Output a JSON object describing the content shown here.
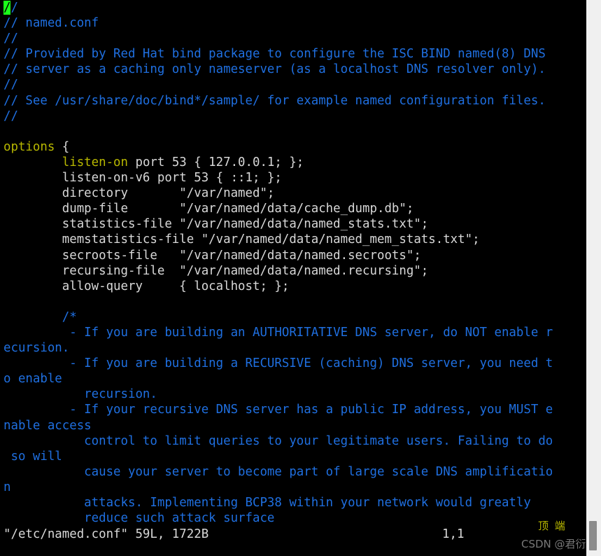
{
  "editor": {
    "app": "vim",
    "filename": "/etc/named.conf",
    "cursor_char": "/",
    "colors": {
      "background": "#000000",
      "comment": "#1f6fe0",
      "keyword": "#b8b800",
      "text": "#d8d8d8",
      "cursor": "#1aff1a",
      "rail": "#f0f0f0",
      "scroll_thumb": "#8c8c8c"
    },
    "lines": [
      {
        "id": "l1",
        "kind": "comment",
        "cursor": true,
        "text": "//"
      },
      {
        "id": "l2",
        "kind": "comment",
        "cursor": false,
        "text": "// named.conf"
      },
      {
        "id": "l3",
        "kind": "comment",
        "cursor": false,
        "text": "//"
      },
      {
        "id": "l4",
        "kind": "comment",
        "cursor": false,
        "text": "// Provided by Red Hat bind package to configure the ISC BIND named(8) DNS"
      },
      {
        "id": "l5",
        "kind": "comment",
        "cursor": false,
        "text": "// server as a caching only nameserver (as a localhost DNS resolver only)."
      },
      {
        "id": "l6",
        "kind": "comment",
        "cursor": false,
        "text": "//"
      },
      {
        "id": "l7",
        "kind": "comment",
        "cursor": false,
        "text": "// See /usr/share/doc/bind*/sample/ for example named configuration files."
      },
      {
        "id": "l8",
        "kind": "comment",
        "cursor": false,
        "text": "//"
      },
      {
        "id": "l9",
        "kind": "blank",
        "cursor": false,
        "text": ""
      },
      {
        "id": "l10",
        "kind": "keyword_prefix",
        "cursor": false,
        "keyword": "options",
        "text": " {"
      },
      {
        "id": "l11",
        "kind": "indent_keyword",
        "cursor": false,
        "indent": "        ",
        "keyword": "listen-on",
        "text": " port 53 { 127.0.0.1; };"
      },
      {
        "id": "l12",
        "kind": "plain",
        "cursor": false,
        "text": "        listen-on-v6 port 53 { ::1; };"
      },
      {
        "id": "l13",
        "kind": "plain",
        "cursor": false,
        "text": "        directory       \"/var/named\";"
      },
      {
        "id": "l14",
        "kind": "plain",
        "cursor": false,
        "text": "        dump-file       \"/var/named/data/cache_dump.db\";"
      },
      {
        "id": "l15",
        "kind": "plain",
        "cursor": false,
        "text": "        statistics-file \"/var/named/data/named_stats.txt\";"
      },
      {
        "id": "l16",
        "kind": "plain",
        "cursor": false,
        "text": "        memstatistics-file \"/var/named/data/named_mem_stats.txt\";"
      },
      {
        "id": "l17",
        "kind": "plain",
        "cursor": false,
        "text": "        secroots-file   \"/var/named/data/named.secroots\";"
      },
      {
        "id": "l18",
        "kind": "plain",
        "cursor": false,
        "text": "        recursing-file  \"/var/named/data/named.recursing\";"
      },
      {
        "id": "l19",
        "kind": "plain",
        "cursor": false,
        "text": "        allow-query     { localhost; };"
      },
      {
        "id": "l20",
        "kind": "blank",
        "cursor": false,
        "text": ""
      },
      {
        "id": "l21",
        "kind": "comment",
        "cursor": false,
        "text": "        /*"
      },
      {
        "id": "l22",
        "kind": "comment",
        "cursor": false,
        "text": "         - If you are building an AUTHORITATIVE DNS server, do NOT enable r"
      },
      {
        "id": "l23",
        "kind": "comment",
        "cursor": false,
        "text": "ecursion."
      },
      {
        "id": "l24",
        "kind": "comment",
        "cursor": false,
        "text": "         - If you are building a RECURSIVE (caching) DNS server, you need t"
      },
      {
        "id": "l25",
        "kind": "comment",
        "cursor": false,
        "text": "o enable"
      },
      {
        "id": "l26",
        "kind": "comment",
        "cursor": false,
        "text": "           recursion."
      },
      {
        "id": "l27",
        "kind": "comment",
        "cursor": false,
        "text": "         - If your recursive DNS server has a public IP address, you MUST e"
      },
      {
        "id": "l28",
        "kind": "comment",
        "cursor": false,
        "text": "nable access"
      },
      {
        "id": "l29",
        "kind": "comment",
        "cursor": false,
        "text": "           control to limit queries to your legitimate users. Failing to do"
      },
      {
        "id": "l30",
        "kind": "comment",
        "cursor": false,
        "text": " so will"
      },
      {
        "id": "l31",
        "kind": "comment",
        "cursor": false,
        "text": "           cause your server to become part of large scale DNS amplificatio"
      },
      {
        "id": "l32",
        "kind": "comment",
        "cursor": false,
        "text": "n"
      },
      {
        "id": "l33",
        "kind": "comment",
        "cursor": false,
        "text": "           attacks. Implementing BCP38 within your network would greatly"
      },
      {
        "id": "l34",
        "kind": "comment",
        "cursor": false,
        "text": "           reduce such attack surface"
      }
    ]
  },
  "statusline": {
    "file_info": "\"/etc/named.conf\" 59L, 1722B",
    "file_name_quoted": "\"/etc/named.conf\"",
    "line_count": "59L",
    "byte_count": "1722B",
    "position": "1,1",
    "scroll_indicator": "顶 端"
  },
  "watermark": {
    "text": "CSDN @君衍."
  }
}
